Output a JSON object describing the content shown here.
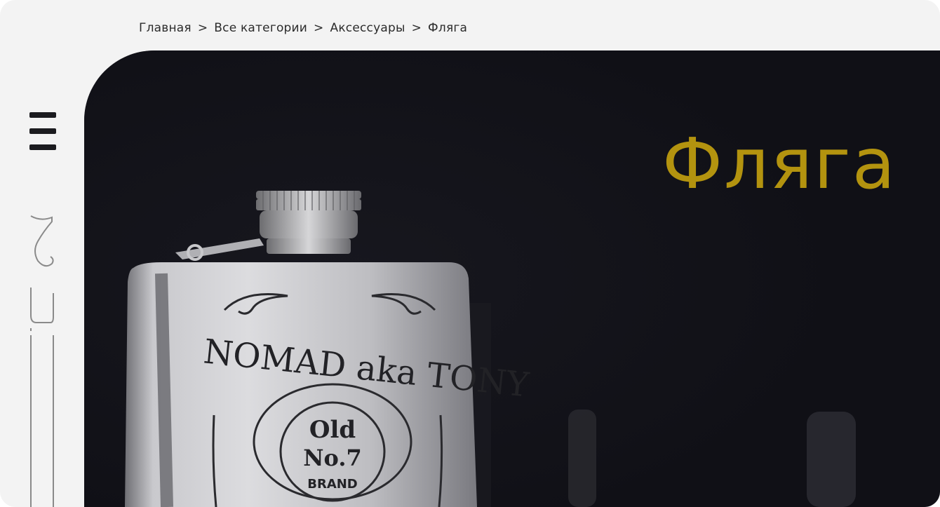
{
  "breadcrumb": {
    "items": [
      "Главная",
      "Все категории",
      "Аксессуары",
      "Фляга"
    ],
    "separator": ">"
  },
  "hero": {
    "title": "Фляга",
    "title_color": "#b3930f",
    "background": "#101016",
    "image": {
      "engraving_line1": "NOMAD aka TONY",
      "label_old": "Old",
      "label_no": "No.7",
      "label_brand": "BRAND"
    }
  },
  "sidebar": {
    "menu_icon": "hamburger-menu-icon",
    "logo_icon": "brand-logo-icon"
  }
}
